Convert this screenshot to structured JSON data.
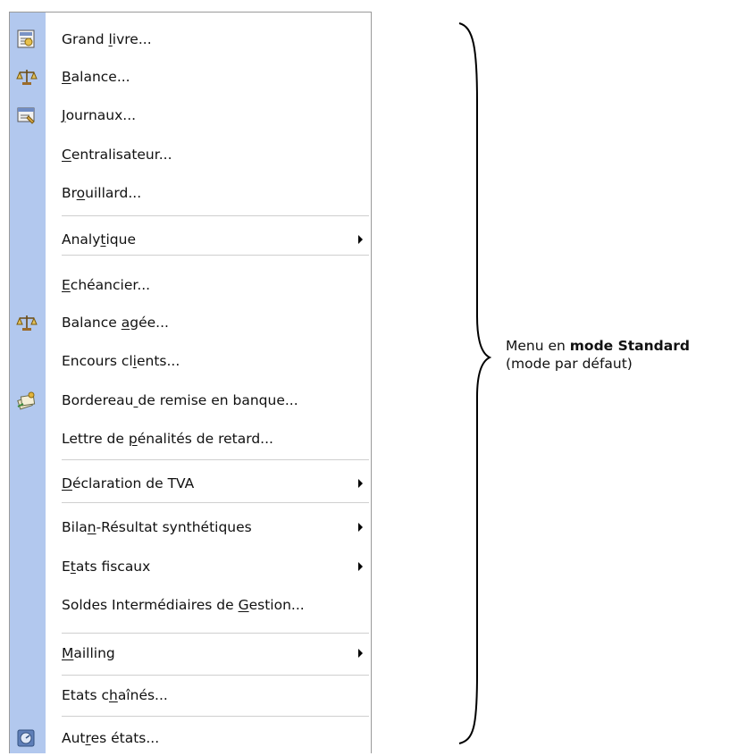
{
  "menu": {
    "items": [
      {
        "name": "menu-item-grand-livre",
        "before": "Grand ",
        "u": "l",
        "after": "ivre...",
        "icon": "ledger-icon"
      },
      {
        "name": "menu-item-balance",
        "before": "",
        "u": "B",
        "after": "alance...",
        "icon": "balance-icon"
      },
      {
        "name": "menu-item-journaux",
        "before": "",
        "u": "J",
        "after": "ournaux...",
        "icon": "journal-icon"
      },
      {
        "name": "menu-item-centralisateur",
        "before": "",
        "u": "C",
        "after": "entralisateur...",
        "icon": ""
      },
      {
        "name": "menu-item-brouillard",
        "before": "Br",
        "u": "o",
        "after": "uillard...",
        "icon": ""
      },
      {
        "name": "menu-item-analytique",
        "before": "Analy",
        "u": "t",
        "after": "ique",
        "icon": "",
        "submenu": true
      },
      {
        "name": "menu-item-echeancier",
        "before": "",
        "u": "E",
        "after": "chéancier...",
        "icon": ""
      },
      {
        "name": "menu-item-balance-agee",
        "before": "Balance ",
        "u": "a",
        "after": "gée...",
        "icon": "balance-icon"
      },
      {
        "name": "menu-item-encours-clients",
        "before": "Encours cl",
        "u": "i",
        "after": "ents...",
        "icon": ""
      },
      {
        "name": "menu-item-bordereau",
        "before": "Bordereau",
        "u": " ",
        "after": "de remise en banque...",
        "icon": "bank-remittance-icon"
      },
      {
        "name": "menu-item-lettre-penalites",
        "before": "Lettre de ",
        "u": "p",
        "after": "énalités de retard...",
        "icon": ""
      },
      {
        "name": "menu-item-declaration-tva",
        "before": "",
        "u": "D",
        "after": "éclaration de TVA",
        "icon": "",
        "submenu": true
      },
      {
        "name": "menu-item-bilan-resultat",
        "before": "Bila",
        "u": "n",
        "after": "-Résultat synthétiques",
        "icon": "",
        "submenu": true
      },
      {
        "name": "menu-item-etats-fiscaux",
        "before": "E",
        "u": "t",
        "after": "ats fiscaux",
        "icon": "",
        "submenu": true
      },
      {
        "name": "menu-item-soldes-intermediaires",
        "before": "Soldes Intermédiaires de ",
        "u": "G",
        "after": "estion...",
        "icon": ""
      },
      {
        "name": "menu-item-mailling",
        "before": "",
        "u": "M",
        "after": "ailling",
        "icon": "",
        "submenu": true
      },
      {
        "name": "menu-item-etats-chaines",
        "before": "Etats c",
        "u": "h",
        "after": "aînés...",
        "icon": ""
      },
      {
        "name": "menu-item-autres-etats",
        "before": "Aut",
        "u": "r",
        "after": "es états...",
        "icon": "reports-icon"
      }
    ]
  },
  "annotation": {
    "line1_prefix": "Menu en ",
    "line1_bold": "mode Standard",
    "line2": "(mode par défaut)"
  },
  "colors": {
    "gutter": "#b2c8ee",
    "separator": "#cfcfcf"
  }
}
